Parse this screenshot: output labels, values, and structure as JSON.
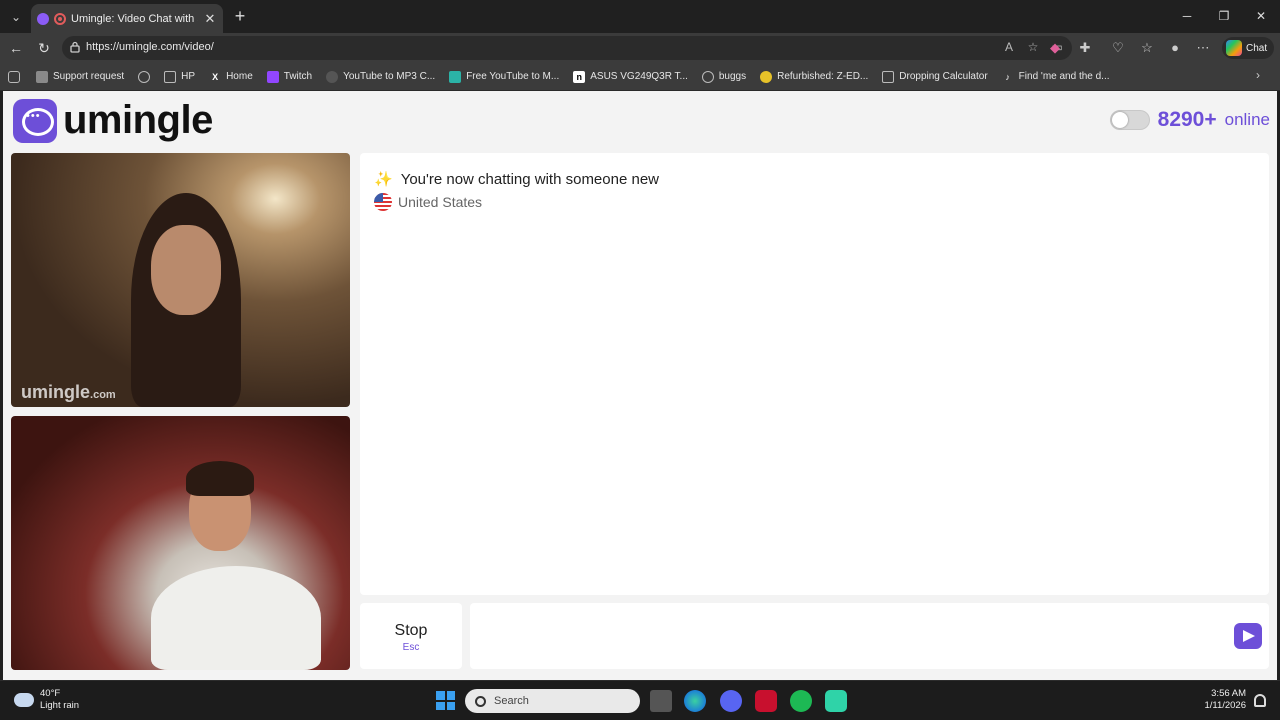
{
  "browser": {
    "tab_title": "Umingle: Video Chat with Stra",
    "url": "https://umingle.com/video/",
    "chat_label": "Chat"
  },
  "bookmarks": [
    {
      "label": "Support request",
      "icon": "support-icon",
      "color": "#8a8a8a"
    },
    {
      "label": "",
      "icon": "globe-icon",
      "color": "#bbbbbb"
    },
    {
      "label": "HP",
      "icon": "folder-icon",
      "color": "#bbbbbb"
    },
    {
      "label": "Home",
      "icon": "x-icon",
      "color": "#ffffff"
    },
    {
      "label": "Twitch",
      "icon": "twitch-icon",
      "color": "#9146ff"
    },
    {
      "label": "YouTube to MP3 C...",
      "icon": "spider-icon",
      "color": "#555555"
    },
    {
      "label": "Free YouTube to M...",
      "icon": "ytm-icon",
      "color": "#2bb3a7"
    },
    {
      "label": "ASUS VG249Q3R T...",
      "icon": "notion-icon",
      "color": "#ffffff"
    },
    {
      "label": "buggs",
      "icon": "globe-icon",
      "color": "#bbbbbb"
    },
    {
      "label": "Refurbished: Z-ED...",
      "icon": "lemon-icon",
      "color": "#e6c229"
    },
    {
      "label": "Dropping Calculator",
      "icon": "calculator-icon",
      "color": "#bbbbbb"
    },
    {
      "label": "Find 'me and the d...",
      "icon": "tiktok-icon",
      "color": "#ffffff"
    }
  ],
  "site": {
    "brand": "umingle",
    "online_count": "8290+",
    "online_label": "online",
    "watermark_main": "umingle",
    "watermark_suffix": ".com",
    "status_message": "You're now chatting with someone new",
    "status_emoji": "✨",
    "country": "United States",
    "stop_label": "Stop",
    "stop_shortcut": "Esc",
    "message_placeholder": ""
  },
  "taskbar": {
    "temperature": "40°F",
    "weather": "Light rain",
    "search_label": "Search",
    "time": "3:56 AM",
    "date": "1/11/2026"
  },
  "colors": {
    "brand_purple": "#6d4fd8"
  }
}
